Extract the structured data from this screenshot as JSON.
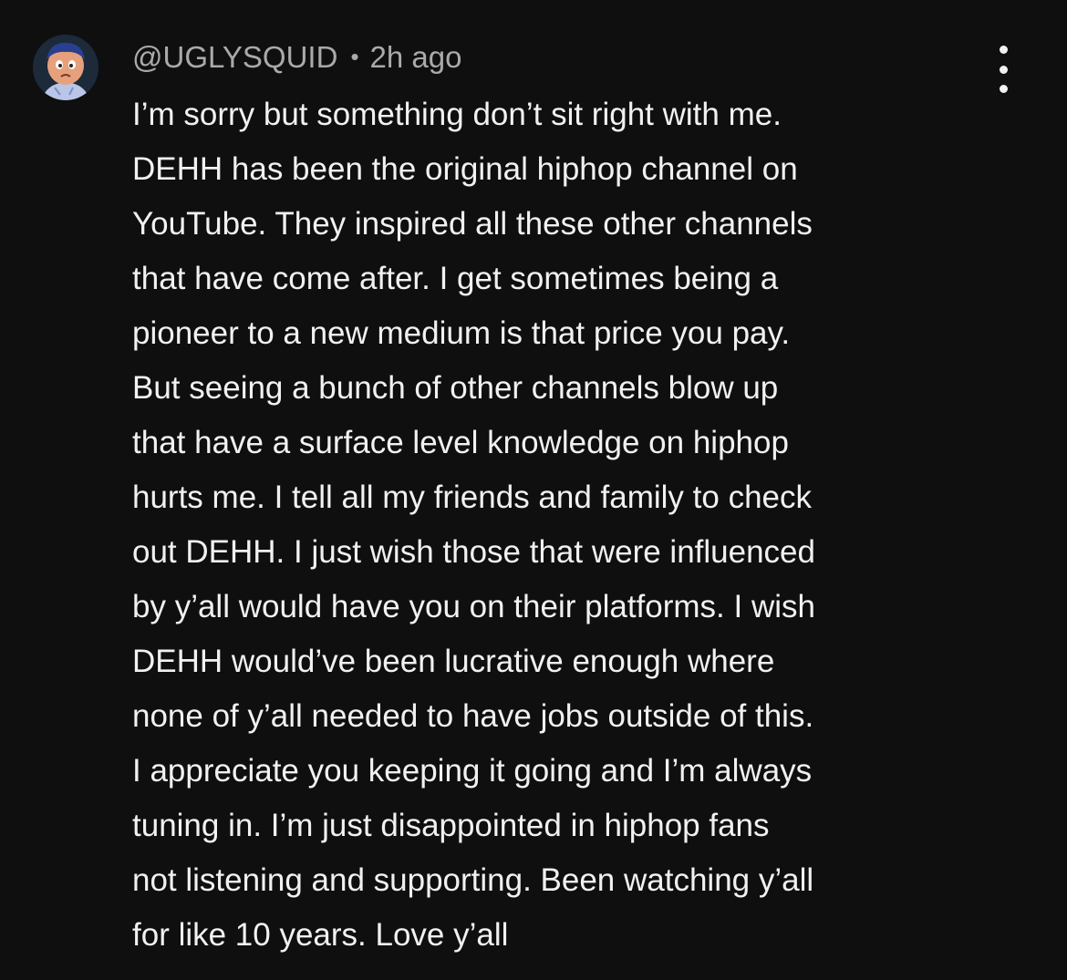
{
  "comment": {
    "author": "@UGLYSQUID",
    "separator": "•",
    "timestamp": "2h ago",
    "avatar_icon": "cartoon-character-avatar",
    "menu_icon": "more-vertical-icon",
    "lines": [
      "I’m sorry but something don’t sit right with me.",
      "DEHH has been the original hiphop channel on",
      "YouTube. They inspired all these other channels",
      "that have come after. I get sometimes being a",
      "pioneer to a new medium is that price you pay.",
      "But seeing a bunch of other channels blow up",
      "that have a surface level knowledge on hiphop",
      "hurts me. I tell all my friends and family to check",
      "out DEHH. I just wish those that were influenced",
      "by y’all would have you on their platforms. I wish",
      "DEHH would’ve been lucrative enough where",
      "none of y’all needed to have jobs outside of this.",
      "I appreciate you keeping it going and I’m always",
      "tuning in. I’m just disappointed in hiphop fans",
      "not listening and supporting. Been watching y’all",
      "for like 10 years. Love y’all"
    ]
  },
  "colors": {
    "background": "#0f0f0f",
    "text": "#f1f1f1",
    "meta": "#aaaaaa"
  }
}
